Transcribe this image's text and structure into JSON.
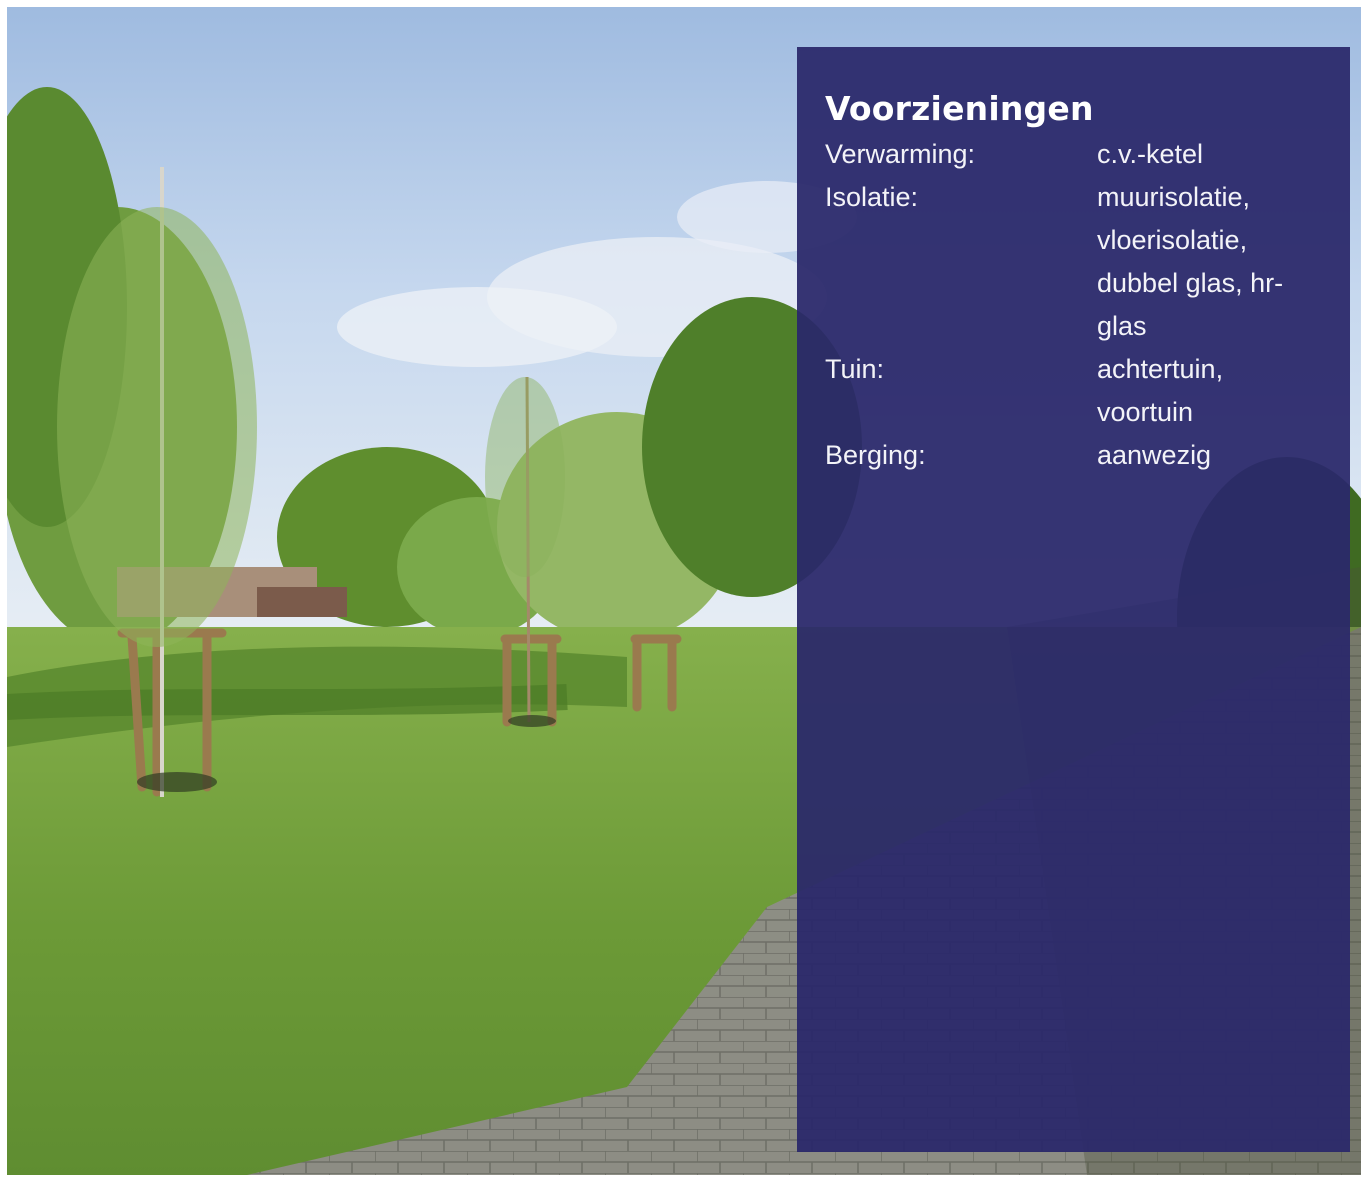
{
  "panel": {
    "title": "Voorzieningen",
    "rows": [
      {
        "label": "Verwarming:",
        "value": "c.v.-ketel"
      },
      {
        "label": "Isolatie:",
        "value": "muurisolatie, vloerisolatie, dubbel glas, hr-glas"
      },
      {
        "label": "Tuin:",
        "value": "achtertuin, voortuin"
      },
      {
        "label": "Berging:",
        "value": "aanwezig"
      }
    ]
  },
  "colors": {
    "panel_background": "#2b286a",
    "sky": "#b8cde6",
    "grass": "#6f9c39",
    "path": "#8d8d8b"
  }
}
